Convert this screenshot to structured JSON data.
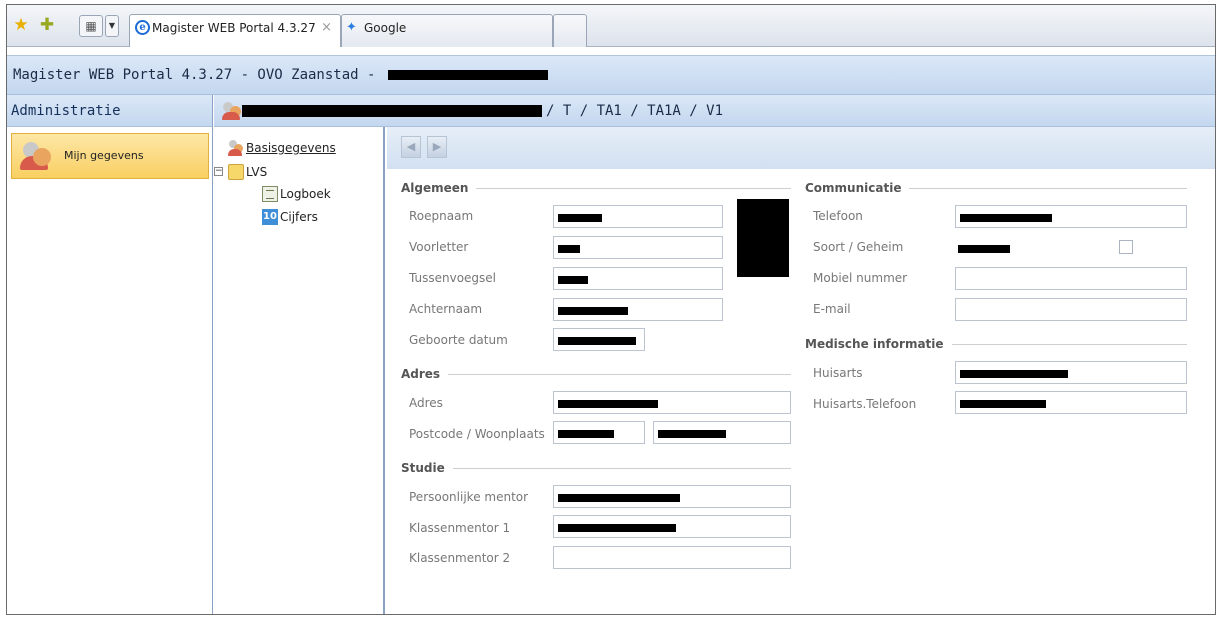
{
  "browser": {
    "tabs": [
      {
        "label": "Magister WEB Portal 4.3.27",
        "active": true
      },
      {
        "label": "Google",
        "active": false
      }
    ],
    "close_glyph": "×"
  },
  "app": {
    "title": "Magister WEB Portal 4.3.27 - OVO Zaanstad -"
  },
  "sidebar": {
    "header": "Administratie",
    "items": [
      {
        "label": "Mijn gegevens",
        "selected": true
      }
    ]
  },
  "record_header": {
    "path": "/ T / TA1 / TA1A / V1"
  },
  "tree": {
    "items": [
      {
        "label": "Basisgegevens",
        "icon": "users-icon"
      },
      {
        "label": "LVS",
        "icon": "folder-icon",
        "expanded": true
      },
      {
        "label": "Logboek",
        "icon": "logbook-icon"
      },
      {
        "label": "Cijfers",
        "icon": "grades-icon",
        "icon_text": "10"
      }
    ]
  },
  "form": {
    "algemeen": {
      "title": "Algemeen",
      "fields": [
        {
          "label": "Roepnaam"
        },
        {
          "label": "Voorletter"
        },
        {
          "label": "Tussenvoegsel"
        },
        {
          "label": "Achternaam"
        },
        {
          "label": "Geboorte datum"
        }
      ]
    },
    "adres": {
      "title": "Adres",
      "fields": [
        {
          "label": "Adres"
        },
        {
          "label": "Postcode / Woonplaats"
        }
      ]
    },
    "studie": {
      "title": "Studie",
      "fields": [
        {
          "label": "Persoonlijke mentor"
        },
        {
          "label": "Klassenmentor 1"
        },
        {
          "label": "Klassenmentor 2"
        }
      ]
    },
    "communicatie": {
      "title": "Communicatie",
      "fields": [
        {
          "label": "Telefoon"
        },
        {
          "label": "Soort / Geheim"
        },
        {
          "label": "Mobiel nummer"
        },
        {
          "label": "E-mail"
        }
      ]
    },
    "medisch": {
      "title": "Medische informatie",
      "fields": [
        {
          "label": "Huisarts"
        },
        {
          "label": "Huisarts.Telefoon"
        }
      ]
    }
  },
  "colors": {
    "accent_band": "#c3d7ef",
    "selected_item": "#f9cf62",
    "redaction": "#000000"
  }
}
